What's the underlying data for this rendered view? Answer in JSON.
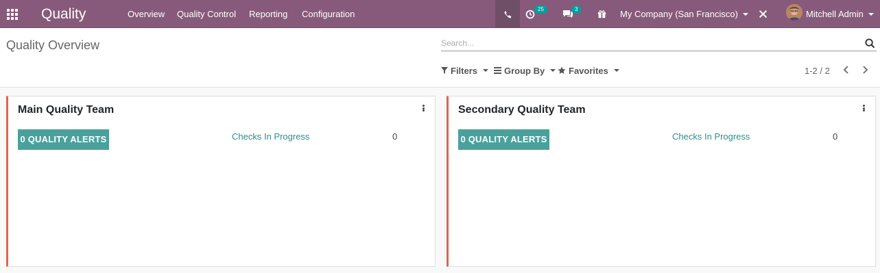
{
  "navbar": {
    "app_title": "Quality",
    "menu": [
      "Overview",
      "Quality Control",
      "Reporting",
      "Configuration"
    ],
    "activity_count": "25",
    "messages_count": "3",
    "company": "My Company (San Francisco)",
    "user_name": "Mitchell Admin",
    "brand_color": "#875a7b"
  },
  "control_panel": {
    "breadcrumb": "Quality Overview",
    "search_placeholder": "Search...",
    "filters_label": "Filters",
    "group_by_label": "Group By",
    "favorites_label": "Favorites",
    "pager_value": "1-2 / 2"
  },
  "teams": [
    {
      "name": "Main Quality Team",
      "alerts_label": "0 QUALITY ALERTS",
      "checks_label": "Checks In Progress",
      "checks_count": "0"
    },
    {
      "name": "Secondary Quality Team",
      "alerts_label": "0 QUALITY ALERTS",
      "checks_label": "Checks In Progress",
      "checks_count": "0"
    }
  ],
  "icons": [
    "apps-grid-icon",
    "phone-icon",
    "clock-icon",
    "comments-icon",
    "gift-icon",
    "debug-icon",
    "avatar",
    "search-icon",
    "filter-icon",
    "bars-icon",
    "star-icon",
    "chevron-left-icon",
    "chevron-right-icon",
    "ellipsis-v-icon"
  ],
  "colors": {
    "accent": "#00a09d",
    "alert_button": "#4aa19c",
    "card_border": "#e0644f",
    "link": "#2a8f8c"
  }
}
